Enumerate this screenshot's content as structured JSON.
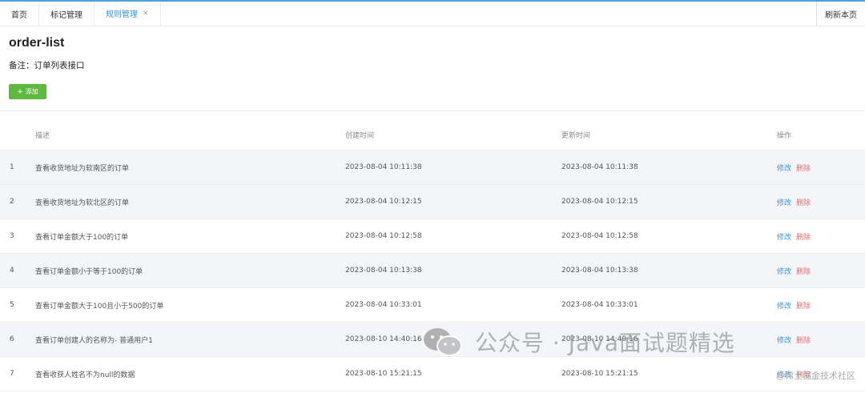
{
  "tabs": [
    {
      "label": "首页",
      "active": false,
      "closable": false
    },
    {
      "label": "标记管理",
      "active": false,
      "closable": false
    },
    {
      "label": "规则管理",
      "active": true,
      "closable": true
    }
  ],
  "tab_close_glyph": "×",
  "refresh_label": "刷新本页",
  "page_title": "order-list",
  "remark": "备注：订单列表接口",
  "add_button": {
    "icon": "+",
    "label": "添加",
    "color": "#5cba3c"
  },
  "table": {
    "headers": {
      "desc": "描述",
      "created": "创建时间",
      "updated": "更新时间",
      "ops": "操作"
    },
    "rows": [
      {
        "no": "1",
        "desc": "查看收货地址为软南区的订单",
        "created": "2023-08-04 10:11:38",
        "updated": "2023-08-04 10:11:38"
      },
      {
        "no": "2",
        "desc": "查看收货地址为软北区的订单",
        "created": "2023-08-04 10:12:15",
        "updated": "2023-08-04 10:12:15"
      },
      {
        "no": "3",
        "desc": "查看订单金额大于100的订单",
        "created": "2023-08-04 10:12:58",
        "updated": "2023-08-04 10:12:58"
      },
      {
        "no": "4",
        "desc": "查看订单金额小于等于100的订单",
        "created": "2023-08-04 10:13:38",
        "updated": "2023-08-04 10:13:38"
      },
      {
        "no": "5",
        "desc": "查看订单金额大于100且小于500的订单",
        "created": "2023-08-04 10:33:01",
        "updated": "2023-08-04 10:33:01"
      },
      {
        "no": "6",
        "desc": "查看订单创建人的名称为- 普通用户1",
        "created": "2023-08-10 14:40:16",
        "updated": "2023-08-10 14:40:16"
      },
      {
        "no": "7",
        "desc": "查看收获人姓名不为null的数据",
        "created": "2023-08-10 15:21:15",
        "updated": "2023-08-10 15:21:15"
      }
    ],
    "edit_label": "修改",
    "delete_label": "删除"
  },
  "colors": {
    "accent": "#3c94d8",
    "delete": "#e36e6e",
    "row_shade": "#f3f5f8"
  },
  "watermark": {
    "text": "公众号 · Java面试题精选",
    "small_text": "@稀土掘金技术社区",
    "icon": "wechat-icon"
  }
}
